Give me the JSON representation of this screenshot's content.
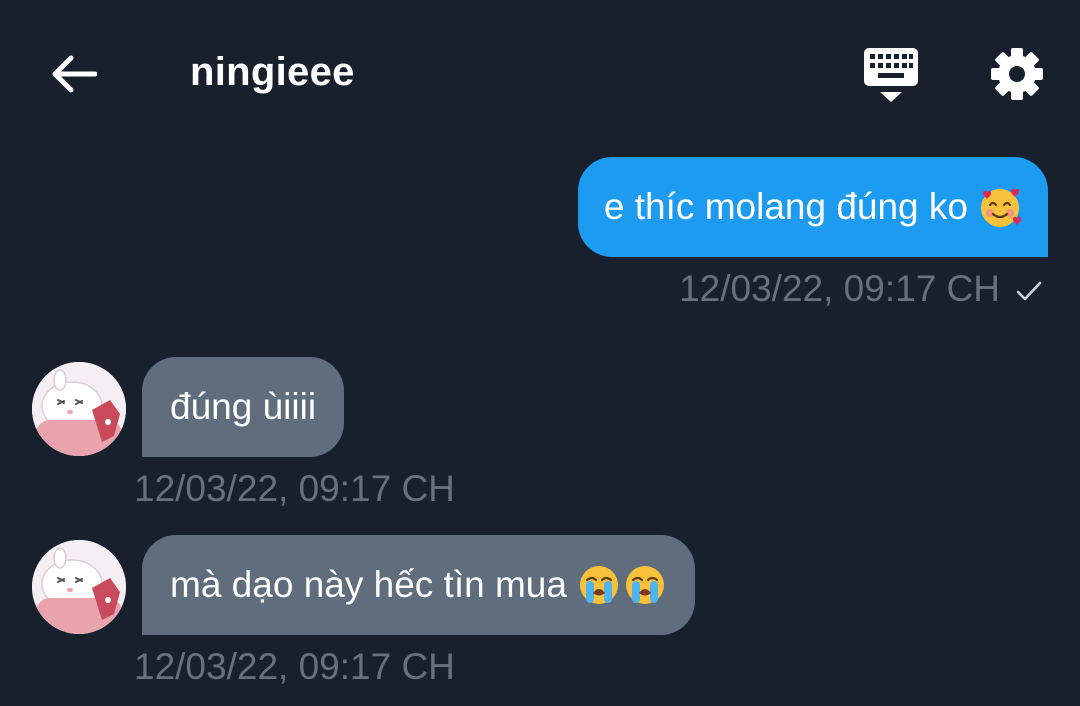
{
  "header": {
    "title": "ningieee",
    "back_icon": "arrow-left-icon",
    "keyboard_icon": "keyboard-icon",
    "settings_icon": "gear-icon"
  },
  "messages": [
    {
      "direction": "outgoing",
      "text": "e thíc molang đúng ko",
      "emojis": [
        "smiling-face-with-hearts-emoji"
      ],
      "timestamp": "12/03/22, 09:17 CH",
      "status_icon": "checkmark-icon"
    },
    {
      "direction": "incoming",
      "text": "đúng ùiiii",
      "emojis": [],
      "timestamp": "12/03/22, 09:17 CH",
      "avatar_icon": "molang-bunny-avatar"
    },
    {
      "direction": "incoming",
      "text": "mà dạo này hếc tìn mua",
      "emojis": [
        "loudly-crying-face-emoji",
        "loudly-crying-face-emoji"
      ],
      "timestamp": "12/03/22, 09:17 CH",
      "avatar_icon": "molang-bunny-avatar"
    }
  ],
  "colors": {
    "background": "#17202c",
    "outgoing_bubble": "#1d9bf0",
    "incoming_bubble": "#5f6d7c",
    "timestamp": "#67717d"
  }
}
